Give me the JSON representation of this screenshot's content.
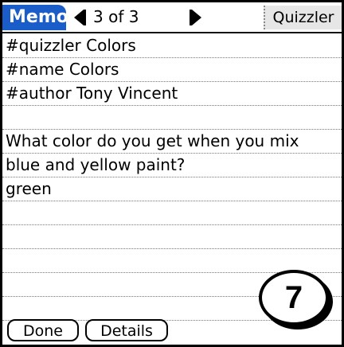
{
  "header": {
    "app_name": "Memo",
    "page_indicator": "3 of 3",
    "category": "Quizzler",
    "accent_color": "#1a5cc8"
  },
  "note": {
    "lines": [
      "#quizzler Colors",
      "#name Colors",
      "#author Tony Vincent",
      "",
      "What color do you get when you mix",
      "blue and yellow paint?",
      "green",
      "",
      "",
      "",
      "",
      ""
    ]
  },
  "buttons": {
    "done_label": "Done",
    "details_label": "Details"
  },
  "step_badge": "7"
}
